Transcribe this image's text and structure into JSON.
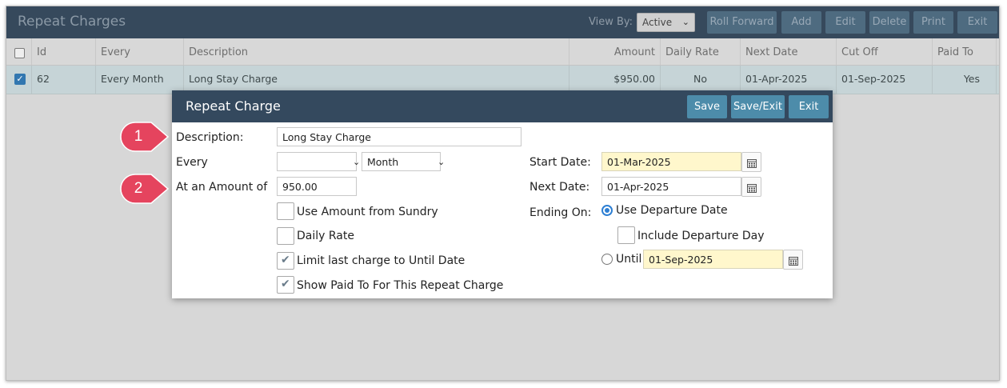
{
  "app": {
    "title": "Repeat Charges",
    "view_by_label": "View By:",
    "view_by_value": "Active",
    "toolbar": {
      "roll_forward": "Roll Forward",
      "add": "Add",
      "edit": "Edit",
      "delete": "Delete",
      "print": "Print",
      "exit": "Exit"
    }
  },
  "grid": {
    "columns": {
      "id": "Id",
      "every": "Every",
      "description": "Description",
      "amount": "Amount",
      "daily_rate": "Daily Rate",
      "next_date": "Next Date",
      "cut_off": "Cut Off",
      "paid_to": "Paid To"
    },
    "row": {
      "selected": true,
      "id": "62",
      "every": "Every Month",
      "description": "Long Stay Charge",
      "amount": "$950.00",
      "daily_rate": "No",
      "next_date": "01-Apr-2025",
      "cut_off": "01-Sep-2025",
      "paid_to": "Yes"
    }
  },
  "dialog": {
    "title": "Repeat Charge",
    "buttons": {
      "save": "Save",
      "save_exit": "Save/Exit",
      "exit": "Exit"
    },
    "description": {
      "label": "Description:",
      "value": "Long Stay Charge"
    },
    "every": {
      "label": "Every",
      "count_value": "",
      "unit_value": "Month"
    },
    "amount": {
      "label": "At an Amount of",
      "value": "950.00"
    },
    "checkboxes": {
      "use_amount_sundry": {
        "label": "Use Amount from Sundry",
        "checked": false
      },
      "daily_rate": {
        "label": "Daily Rate",
        "checked": false
      },
      "limit_last_charge": {
        "label": "Limit last charge to Until Date",
        "checked": true
      },
      "show_paid_to": {
        "label": "Show Paid To For This Repeat Charge",
        "checked": true
      }
    },
    "start_date": {
      "label": "Start Date:",
      "value": "01-Mar-2025"
    },
    "next_date": {
      "label": "Next Date:",
      "value": "01-Apr-2025"
    },
    "ending_on": {
      "label": "Ending On:",
      "use_departure_date": {
        "label": "Use Departure Date",
        "selected": true
      },
      "include_departure_day": {
        "label": "Include Departure Day",
        "checked": false
      },
      "until": {
        "label": "Until",
        "selected": false,
        "value": "01-Sep-2025"
      }
    }
  },
  "callouts": {
    "first": "1",
    "second": "2"
  },
  "colors": {
    "header_bg": "#36495c",
    "dialog_header_bg": "#34495e",
    "dialog_button_bg": "#4d8caa",
    "callout": "#e5445e",
    "date_field_bg": "#fff7cc",
    "radio_selected": "#2d7fd3"
  },
  "icons": {
    "calendar": "calendar-icon",
    "chevron": "chevron-down-icon",
    "check": "check-icon"
  }
}
